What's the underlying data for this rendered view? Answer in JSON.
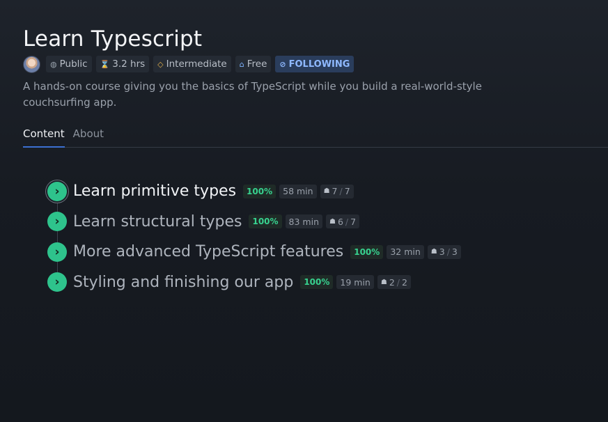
{
  "course": {
    "title": "Learn Typescript",
    "description": "A hands-on course giving you the basics of TypeScript while you build a real-world-style couchsurfing app.",
    "meta": {
      "visibility": "Public",
      "duration": "3.2 hrs",
      "level": "Intermediate",
      "price": "Free",
      "follow": "FOLLOWING"
    },
    "icons": {
      "visibility": "globe-icon",
      "duration": "hourglass-icon",
      "level": "diamond-icon",
      "price": "gift-icon",
      "follow": "bell-off-icon"
    }
  },
  "tabs": [
    {
      "label": "Content",
      "active": true
    },
    {
      "label": "About",
      "active": false
    }
  ],
  "lessons": [
    {
      "title": "Learn primitive types",
      "progress": "100%",
      "duration": "58 min",
      "done": "7",
      "total": "7"
    },
    {
      "title": "Learn structural types",
      "progress": "100%",
      "duration": "83 min",
      "done": "6",
      "total": "7"
    },
    {
      "title": "More advanced TypeScript features",
      "progress": "100%",
      "duration": "32 min",
      "done": "3",
      "total": "3"
    },
    {
      "title": "Styling and finishing our app",
      "progress": "100%",
      "duration": "19 min",
      "done": "2",
      "total": "2"
    }
  ],
  "colors": {
    "accent": "#2ec38c",
    "link": "#3c6fd1",
    "following": "#8fb9ff"
  }
}
